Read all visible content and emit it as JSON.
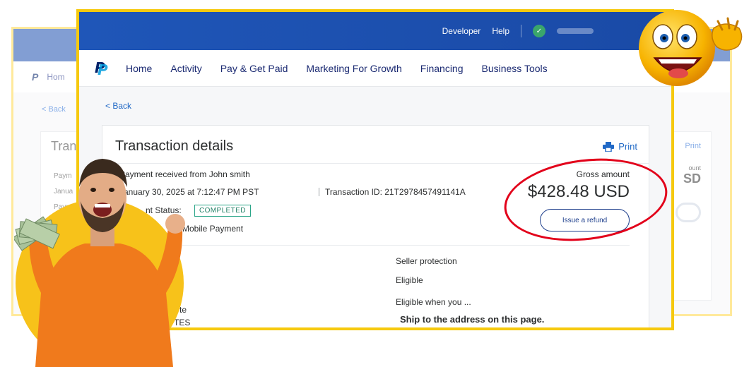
{
  "header": {
    "developer": "Developer",
    "help": "Help"
  },
  "nav": {
    "items": [
      "Home",
      "Activity",
      "Pay & Get Paid",
      "Marketing For Growth",
      "Financing",
      "Business Tools"
    ]
  },
  "back": "< Back",
  "card": {
    "title": "Transaction details",
    "print": "Print"
  },
  "transaction": {
    "received_from": "Payment received from John smith",
    "date": "January 30, 2025 at 7:12:47 PM PST",
    "transaction_id": "Transaction ID: 21T2978457491141A",
    "status_label_partial": "nt Status:",
    "status_badge": "COMPLETED",
    "payment_type_partial": "Mobile Payment",
    "gross_label": "Gross amount",
    "gross_amount": "$428.48 USD",
    "refund_button": "Issue a refund"
  },
  "seller_protection": {
    "title": "Seller protection",
    "status": "Eligible",
    "when": "Eligible when you ...",
    "ship": "Ship to the address on this page."
  },
  "partial_left": {
    "line1": "te",
    "line2": "TES"
  },
  "background_window": {
    "nav_partial": "Hom",
    "back": "< Back",
    "title_partial": "Tran",
    "print": "Print",
    "rows": [
      "Paym",
      "Janua",
      "Paym"
    ],
    "amount_partial": "SD",
    "label_partial": "ount"
  },
  "colors": {
    "header_blue": "#1f56b8",
    "nav_text": "#1b2a72",
    "link_blue": "#2169c6",
    "highlight_red": "#e2001a",
    "frame_yellow": "#f6c90e",
    "badge_green": "#2aa588"
  }
}
